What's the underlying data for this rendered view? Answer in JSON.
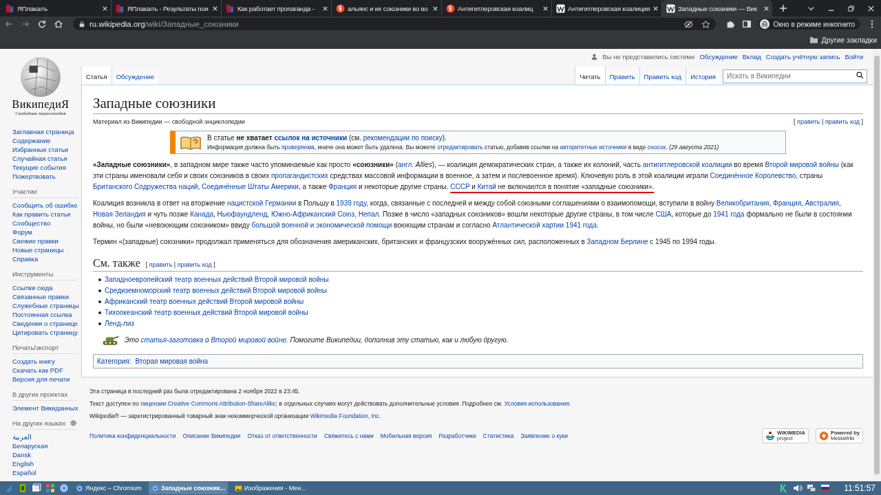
{
  "browser": {
    "tabs": [
      {
        "title": "ЯПлакалъ",
        "kind": "yaplakal",
        "selected": false
      },
      {
        "title": "ЯПлакалъ - Результаты пои",
        "kind": "yaplakal",
        "selected": false
      },
      {
        "title": "Как работает пропаганда -",
        "kind": "yaplakal",
        "selected": false
      },
      {
        "title": "альянс и их союзники во во",
        "kind": "yandex",
        "selected": false
      },
      {
        "title": "Антигитлеровская коалиц",
        "kind": "yandex",
        "selected": false
      },
      {
        "title": "Антигитлеровская коалиция",
        "kind": "wiki",
        "selected": false
      },
      {
        "title": "Западные союзники — Вик",
        "kind": "wiki",
        "selected": true
      }
    ],
    "address": {
      "host": "ru.wikipedia.org",
      "path": "/wiki/Западные_союзники"
    },
    "profile": "Окно в режиме инкогнито",
    "bookmarks_folder": "Другие закладки"
  },
  "sidebar": {
    "wordmark": "ВикипедиЯ",
    "tagline": "Свободная энциклопедия",
    "sections": [
      {
        "kind": "nav",
        "items": [
          "Заглавная страница",
          "Содержание",
          "Избранные статьи",
          "Случайная статья",
          "Текущие события",
          "Пожертвовать"
        ]
      },
      {
        "kind": "nav",
        "heading": "Участие",
        "items": [
          "Сообщить об ошибке",
          "Как править статьи",
          "Сообщество",
          "Форум",
          "Свежие правки",
          "Новые страницы",
          "Справка"
        ]
      },
      {
        "kind": "nav",
        "heading": "Инструменты",
        "items": [
          "Ссылки сюда",
          "Связанные правки",
          "Служебные страницы",
          "Постоянная ссылка",
          "Сведения о странице",
          "Цитировать страницу"
        ]
      },
      {
        "kind": "nav",
        "heading": "Печать/экспорт",
        "items": [
          "Создать книгу",
          "Скачать как PDF",
          "Версия для печати"
        ]
      },
      {
        "kind": "nav",
        "heading": "В других проектах",
        "items": [
          "Элемент Викиданных"
        ]
      },
      {
        "kind": "languages",
        "heading": "На других языках",
        "items": [
          "العربية",
          "Беларуская",
          "Dansk",
          "English",
          "Español"
        ]
      }
    ]
  },
  "personal": {
    "status": "Вы не представились системе",
    "links": [
      "Обсуждение",
      "Вклад",
      "Создать учётную запись",
      "Войти"
    ]
  },
  "namespace_tabs": [
    {
      "label": "Статья",
      "selected": true
    },
    {
      "label": "Обсуждение",
      "selected": false
    }
  ],
  "view_tabs": [
    {
      "label": "Читать",
      "selected": true
    },
    {
      "label": "Править",
      "selected": false
    },
    {
      "label": "Править код",
      "selected": false
    },
    {
      "label": "История",
      "selected": false
    }
  ],
  "search": {
    "placeholder": "Искать в Википедии"
  },
  "article": {
    "title": "Западные союзники",
    "tagline": "Материал из Википедии — свободной энциклопедии",
    "title_edit": [
      {
        "kind": "text",
        "text": "[ "
      },
      {
        "kind": "link",
        "text": "править"
      },
      {
        "kind": "text",
        "text": " | "
      },
      {
        "kind": "link",
        "text": "править код"
      },
      {
        "kind": "text",
        "text": " ]"
      }
    ],
    "notice": {
      "lines": [
        [
          {
            "kind": "text",
            "text": "В статье "
          },
          {
            "kind": "bold",
            "text": "не хватает "
          },
          {
            "kind": "bold_link",
            "text": "ссылок на источники"
          },
          {
            "kind": "text",
            "text": " (см. "
          },
          {
            "kind": "link",
            "text": "рекомендации по поиску"
          },
          {
            "kind": "text",
            "text": ")."
          }
        ],
        [
          {
            "kind": "text",
            "text": "Информация должна быть "
          },
          {
            "kind": "link",
            "text": "проверяема"
          },
          {
            "kind": "text",
            "text": ", иначе она может быть удалена. Вы можете "
          },
          {
            "kind": "link",
            "text": "отредактировать"
          },
          {
            "kind": "text",
            "text": " статью, добавив ссылки на "
          },
          {
            "kind": "link",
            "text": "авторитетные источники"
          },
          {
            "kind": "text",
            "text": " в виде "
          },
          {
            "kind": "link",
            "text": "сносок"
          },
          {
            "kind": "text",
            "text": ". "
          },
          {
            "kind": "italic",
            "text": "(29 августа 2021)"
          }
        ]
      ]
    },
    "paragraphs": [
      [
        {
          "kind": "bold",
          "text": "«Западные союзники»"
        },
        {
          "kind": "text",
          "text": ", в западном мире также часто упоминаемые как просто "
        },
        {
          "kind": "bold",
          "text": "«союзники»"
        },
        {
          "kind": "text",
          "text": " ("
        },
        {
          "kind": "link",
          "text": "англ."
        },
        {
          "kind": "italic",
          "text": " Allies"
        },
        {
          "kind": "text",
          "text": "), — коалиция демократических стран, а также их колоний, часть "
        },
        {
          "kind": "link",
          "text": "антигитлеровской коалиции"
        },
        {
          "kind": "text",
          "text": " во время "
        },
        {
          "kind": "link",
          "text": "Второй мировой войны"
        },
        {
          "kind": "text",
          "text": " (как эти страны именовали себя и своих союзников в своих "
        },
        {
          "kind": "link",
          "text": "пропагандистских"
        },
        {
          "kind": "text",
          "text": " средствах массовой информации в военное, а затем и послевоенное время). Ключевую роль в этой коалиции играли "
        },
        {
          "kind": "link",
          "text": "Соединённое Королевство"
        },
        {
          "kind": "text",
          "text": ", страны "
        },
        {
          "kind": "link",
          "text": "Британского Содружества наций"
        },
        {
          "kind": "text",
          "text": ", "
        },
        {
          "kind": "link",
          "text": "Соединённые Штаты Америки"
        },
        {
          "kind": "text",
          "text": ", а также "
        },
        {
          "kind": "link",
          "text": "Франция"
        },
        {
          "kind": "text",
          "text": " и некоторые другие страны. "
        },
        {
          "kind": "link",
          "text": "СССР",
          "marked": true
        },
        {
          "kind": "text",
          "text": " и ",
          "marked": true
        },
        {
          "kind": "link",
          "text": "Китай",
          "marked": true
        },
        {
          "kind": "text",
          "text": " не включаются в понятие «западные союзники».",
          "marked": true
        }
      ],
      [
        {
          "kind": "text",
          "text": "Коалиция возникла в ответ на вторжение "
        },
        {
          "kind": "link",
          "text": "нацистской Германии"
        },
        {
          "kind": "text",
          "text": " в Польшу в "
        },
        {
          "kind": "link",
          "text": "1939 году"
        },
        {
          "kind": "text",
          "text": ", когда, связанные с последней и между собой союзными соглашениями о взаимопомощи, вступили в войну "
        },
        {
          "kind": "link",
          "text": "Великобритания"
        },
        {
          "kind": "text",
          "text": ", "
        },
        {
          "kind": "link",
          "text": "Франция"
        },
        {
          "kind": "text",
          "text": ", "
        },
        {
          "kind": "link",
          "text": "Австралия"
        },
        {
          "kind": "text",
          "text": ", "
        },
        {
          "kind": "link",
          "text": "Новая Зеландия"
        },
        {
          "kind": "text",
          "text": " и чуть позже "
        },
        {
          "kind": "link",
          "text": "Канада"
        },
        {
          "kind": "text",
          "text": ", "
        },
        {
          "kind": "link",
          "text": "Ньюфаундленд"
        },
        {
          "kind": "text",
          "text": ", "
        },
        {
          "kind": "link",
          "text": "Южно-Африканский Союз"
        },
        {
          "kind": "text",
          "text": ", "
        },
        {
          "kind": "link",
          "text": "Непал"
        },
        {
          "kind": "text",
          "text": ". Позже в число «западных союзников» вошли некоторые другие страны, в том числе "
        },
        {
          "kind": "link",
          "text": "США"
        },
        {
          "kind": "text",
          "text": ", которые до "
        },
        {
          "kind": "link",
          "text": "1941 года"
        },
        {
          "kind": "text",
          "text": " формально не были в состоянии войны, но были «невоюющим союзником» ввиду "
        },
        {
          "kind": "link",
          "text": "большой военной и экономической помощи"
        },
        {
          "kind": "text",
          "text": " воюющим странам и согласно "
        },
        {
          "kind": "link",
          "text": "Атлантической хартии 1941 года"
        },
        {
          "kind": "text",
          "text": "."
        }
      ],
      [
        {
          "kind": "text",
          "text": "Термин «(западные) союзники» продолжал применяться для обозначения американских, британских и французских вооружённых сил, расположенных в "
        },
        {
          "kind": "link",
          "text": "Западном Берлине"
        },
        {
          "kind": "text",
          "text": " с 1945 по 1994 годы."
        }
      ]
    ],
    "see_also": {
      "heading": "См. также",
      "edit": [
        {
          "kind": "text",
          "text": "[ "
        },
        {
          "kind": "link",
          "text": "править"
        },
        {
          "kind": "text",
          "text": " | "
        },
        {
          "kind": "link",
          "text": "править код"
        },
        {
          "kind": "text",
          "text": " ]"
        }
      ],
      "items": [
        "Западноевропейский театр военных действий Второй мировой войны",
        "Средиземноморский театр военных действий Второй мировой войны",
        "Африканский театр военных действий Второй мировой войны",
        "Тихоокеанский театр военных действий Второй мировой войны",
        "Ленд-лиз"
      ]
    },
    "stub": [
      {
        "kind": "italic",
        "text": "Это "
      },
      {
        "kind": "italic_link",
        "text": "статья-заготовка"
      },
      {
        "kind": "italic",
        "text": " о "
      },
      {
        "kind": "italic_link",
        "text": "Второй мировой войне"
      },
      {
        "kind": "italic",
        "text": ". Помогите Википедии, дополнив эту статью, как и любую другую."
      }
    ],
    "category": {
      "label": "Категория:",
      "items": [
        "Вторая мировая война"
      ]
    }
  },
  "footer": {
    "lines": [
      [
        {
          "kind": "text",
          "text": "Эта страница в последний раз была отредактирована 2 ноября 2022 в 23:45."
        }
      ],
      [
        {
          "kind": "text",
          "text": "Текст доступен по "
        },
        {
          "kind": "link",
          "text": "лицензии Creative Commons Attribution-ShareAlike"
        },
        {
          "kind": "text",
          "text": "; в отдельных случаях могут действовать дополнительные условия. Подробнее см. "
        },
        {
          "kind": "link",
          "text": "Условия использования"
        },
        {
          "kind": "text",
          "text": "."
        }
      ],
      [
        {
          "kind": "text",
          "text": "Wikipedia® — зарегистрированный товарный знак некоммерческой организации "
        },
        {
          "kind": "link",
          "text": "Wikimedia Foundation, Inc."
        }
      ]
    ],
    "links": [
      "Политика конфиденциальности",
      "Описание Википедии",
      "Отказ от ответственности",
      "Свяжитесь с нами",
      "Мобильная версия",
      "Разработчики",
      "Статистика",
      "Заявление о куки"
    ],
    "badges": [
      {
        "kind": "wikimedia",
        "lines": [
          "WIKIMEDIA",
          "project"
        ]
      },
      {
        "kind": "mediawiki",
        "lines": [
          "Powered by",
          "MediaWiki"
        ]
      }
    ]
  },
  "taskbar": {
    "windows": [
      {
        "title": "Яндекс – Chromium",
        "kind": "browser",
        "selected": false
      },
      {
        "title": "Западные союзник...",
        "kind": "browser",
        "selected": true
      },
      {
        "title": "Изображения - Мен...",
        "kind": "viewer",
        "selected": false
      }
    ],
    "clock": "11:51:57"
  }
}
